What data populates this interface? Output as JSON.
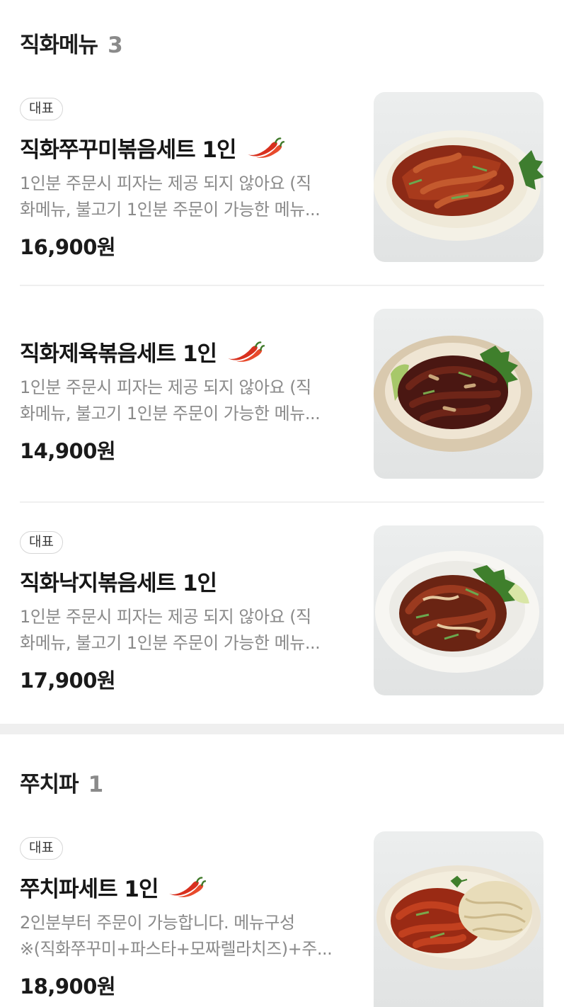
{
  "sections": [
    {
      "title": "직화메뉴",
      "count": "3",
      "items": [
        {
          "badge": "대표",
          "name": "직화쭈꾸미볶음세트 1인",
          "spicy_icon": "chili-pepper-icon",
          "desc_line1": "1인분 주문시 피자는 제공 되지 않아요 (직",
          "desc_line2": "화메뉴, 불고기 1인분 주문이 가능한 메뉴...",
          "price": "16,900원"
        },
        {
          "name": "직화제육볶음세트 1인",
          "spicy_icon": "chili-pepper-icon",
          "desc_line1": "1인분 주문시 피자는 제공 되지 않아요 (직",
          "desc_line2": "화메뉴, 불고기 1인분 주문이 가능한 메뉴...",
          "price": "14,900원"
        },
        {
          "badge": "대표",
          "name": "직화낙지볶음세트 1인",
          "desc_line1": "1인분 주문시 피자는 제공 되지 않아요 (직",
          "desc_line2": "화메뉴, 불고기 1인분 주문이 가능한 메뉴...",
          "price": "17,900원"
        }
      ]
    },
    {
      "title": "쭈치파",
      "count": "1",
      "items": [
        {
          "badge": "대표",
          "name": "쭈치파세트 1인",
          "spicy_icon": "chili-pepper-icon",
          "desc_line1": "2인분부터 주문이 가능합니다. 메뉴구성",
          "desc_line2": "※(직화쭈꾸미+파스타+모짜렐라치즈)+주...",
          "price": "18,900원"
        }
      ]
    }
  ],
  "colors": {
    "chili": "#d8301e",
    "chili_stem": "#3f7a2a",
    "muted_text": "#8a8a8a",
    "divider": "#efefef"
  }
}
